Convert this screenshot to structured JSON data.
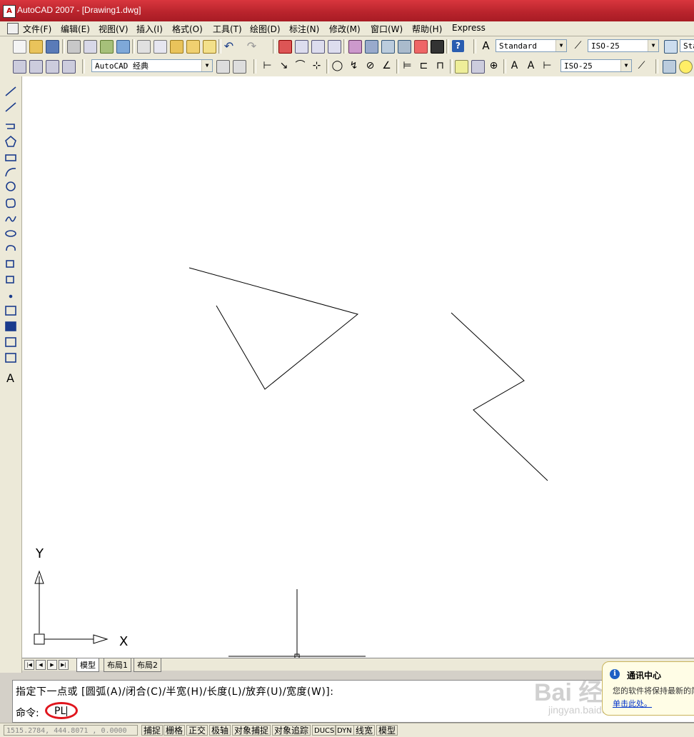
{
  "window": {
    "title": "AutoCAD 2007 - [Drawing1.dwg]",
    "icon_name": "autocad-app-icon"
  },
  "menu": {
    "items": [
      "文件(F)",
      "编辑(E)",
      "视图(V)",
      "插入(I)",
      "格式(O)",
      "工具(T)",
      "绘图(D)",
      "标注(N)",
      "修改(M)",
      "窗口(W)",
      "帮助(H)",
      "Express"
    ]
  },
  "toolbar1": {
    "text_style": "Standard",
    "dim_style": "ISO-25",
    "table_style": "Sta"
  },
  "toolbar2": {
    "workspace": "AutoCAD 经典",
    "dim_style": "ISO-25"
  },
  "layout_tabs": [
    "模型",
    "布局1",
    "布局2"
  ],
  "ucs": {
    "x_label": "X",
    "y_label": "Y"
  },
  "command": {
    "prompt": "指定下一点或 [圆弧(A)/闭合(C)/半宽(H)/长度(L)/放弃(U)/宽度(W)]:",
    "label": "命令:",
    "input_value": "PL"
  },
  "status": {
    "coordinates": "1515.2784, 444.8071 , 0.0000",
    "buttons": [
      "捕捉",
      "栅格",
      "正交",
      "极轴",
      "对象捕捉",
      "对象追踪",
      "DUCS",
      "DYN",
      "线宽",
      "模型"
    ]
  },
  "notification": {
    "title": "通讯中心",
    "body": "您的软件将保持最新的简单",
    "link": "单击此处。"
  },
  "watermark": {
    "text": "Bai 经验",
    "sub": "jingyan.baidu.com"
  },
  "colors": {
    "titlebar": "#b8232c",
    "highlight_circle": "#e0151d",
    "canvas": "#ffffff"
  }
}
